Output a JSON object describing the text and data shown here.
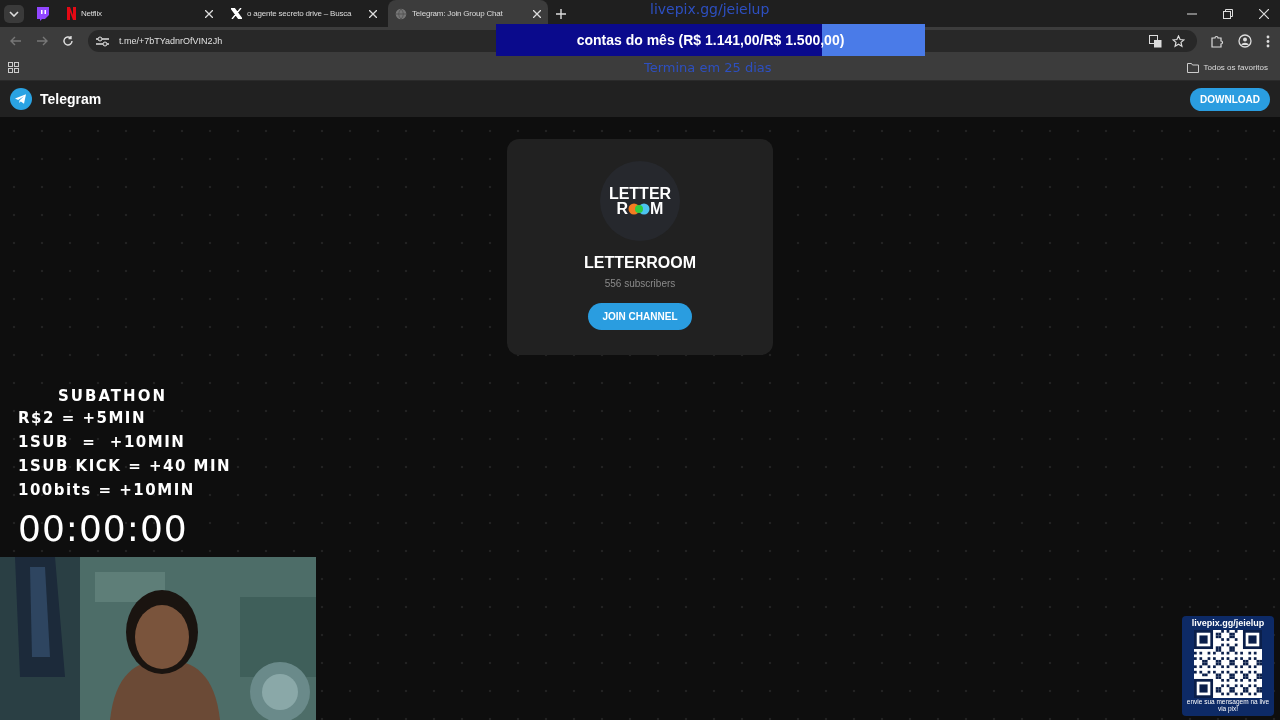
{
  "browser": {
    "tabs": [
      {
        "kind": "pinned",
        "selected": false
      },
      {
        "kind": "normal",
        "label": "Netflix",
        "selected": false
      },
      {
        "kind": "normal",
        "label": "o agente secreto drive – Busca",
        "selected": false
      },
      {
        "kind": "normal",
        "label": "Telegram: Join Group Chat",
        "selected": true
      }
    ],
    "address": "t.me/+7bTYadnrOfVIN2Jh",
    "bookmarks": "Todos os favoritos"
  },
  "telegram": {
    "brand": "Telegram",
    "download": "DOWNLOAD",
    "channel": {
      "logo": {
        "top": "LETTER",
        "left": "R",
        "right": "M"
      },
      "title": "LETTERROOM",
      "subscribers": "556 subscribers",
      "join": "JOIN CHANNEL"
    }
  },
  "overlay": {
    "goal": {
      "site": "livepix.gg/jeielup",
      "text": "contas do mês (R$ 1.141,00/R$ 1.500,00)",
      "level": 0.76,
      "footer": "Termina em 25 dias"
    },
    "subathon": {
      "title": "SUBATHON",
      "rules": [
        "R$2 = +5MIN",
        "1SUB  =  +10MIN",
        "1SUB KICK = +40 MIN",
        "100bits = +10MIN"
      ]
    },
    "timer": "00:00:00",
    "pix": {
      "site": "livepix.gg/jeielup",
      "message": "envie sua mensagem na live via pix!"
    }
  }
}
